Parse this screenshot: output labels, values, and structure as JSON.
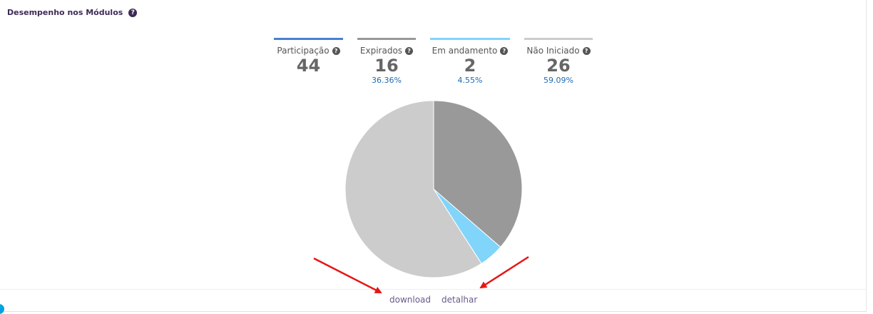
{
  "card": {
    "title": "Desempenho nos Módulos",
    "help_icon": "question-circle-icon"
  },
  "stats": [
    {
      "label": "Participação",
      "value": "44",
      "percent": "",
      "color": "#4a7fd4"
    },
    {
      "label": "Expirados",
      "value": "16",
      "percent": "36.36%",
      "color": "#999999"
    },
    {
      "label": "Em andamento",
      "value": "2",
      "percent": "4.55%",
      "color": "#81d4fa"
    },
    {
      "label": "Não Iniciado",
      "value": "26",
      "percent": "59.09%",
      "color": "#cccccc"
    }
  ],
  "chart_data": {
    "type": "pie",
    "categories": [
      "Expirados",
      "Em andamento",
      "Não Iniciado"
    ],
    "values": [
      16,
      2,
      26
    ],
    "colors": [
      "#999999",
      "#81d4fa",
      "#cccccc"
    ]
  },
  "footer": {
    "download_label": "download",
    "detail_label": "detalhar"
  },
  "annotations": {
    "arrow_color": "#e81414"
  }
}
